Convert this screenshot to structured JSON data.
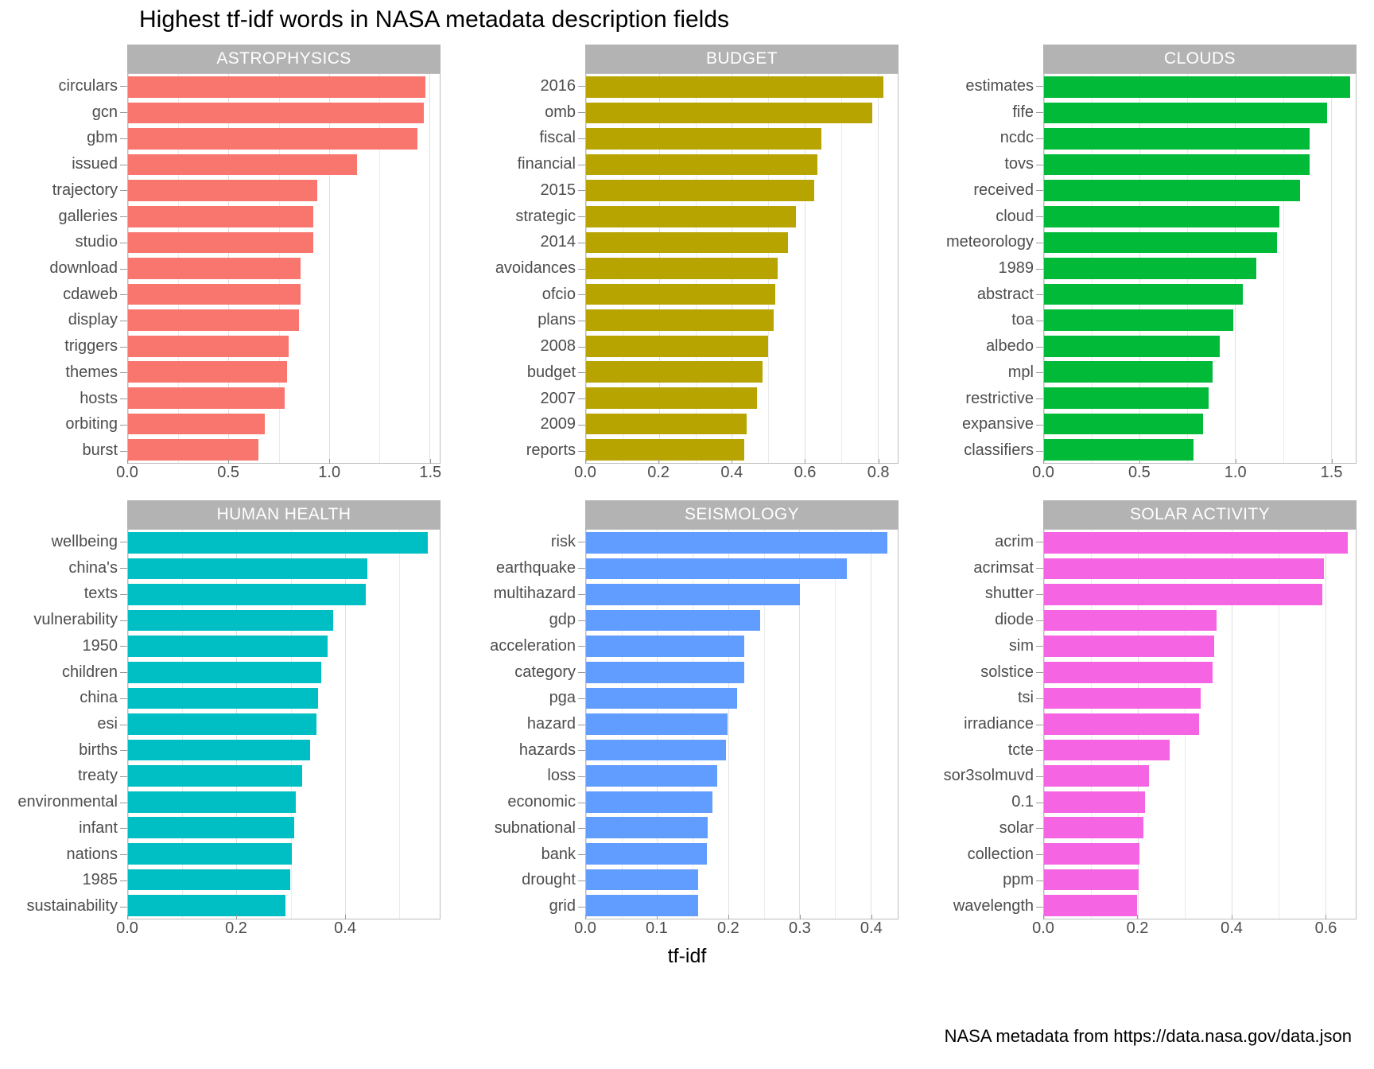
{
  "title": "Highest tf-idf words in NASA metadata description fields",
  "xlabel": "tf-idf",
  "caption": "NASA metadata from https://data.nasa.gov/data.json",
  "chart_data": {
    "type": "bar",
    "title": "Highest tf-idf words in NASA metadata description fields",
    "xlabel": "tf-idf",
    "ylabel": "",
    "orientation": "horizontal",
    "grid": true,
    "legend": "none",
    "facet_layout": "3 columns x 2 rows",
    "caption": "NASA metadata from https://data.nasa.gov/data.json",
    "panels": [
      {
        "name": "ASTROPHYSICS",
        "color": "#f8766d",
        "xlim": [
          0,
          1.55
        ],
        "xticks": [
          0.0,
          0.5,
          1.0,
          1.5
        ],
        "xticklabels": [
          "0.0",
          "0.5",
          "1.0",
          "1.5"
        ],
        "categories": [
          "circulars",
          "gcn",
          "gbm",
          "issued",
          "trajectory",
          "galleries",
          "studio",
          "download",
          "cdaweb",
          "display",
          "triggers",
          "themes",
          "hosts",
          "orbiting",
          "burst"
        ],
        "values": [
          1.48,
          1.47,
          1.44,
          1.14,
          0.94,
          0.92,
          0.92,
          0.86,
          0.86,
          0.85,
          0.8,
          0.79,
          0.78,
          0.68,
          0.65
        ]
      },
      {
        "name": "BUDGET",
        "color": "#b8a400",
        "xlim": [
          0,
          0.855
        ],
        "xticks": [
          0.0,
          0.2,
          0.4,
          0.6,
          0.8
        ],
        "xticklabels": [
          "0.0",
          "0.2",
          "0.4",
          "0.6",
          "0.8"
        ],
        "categories": [
          "2016",
          "omb",
          "fiscal",
          "financial",
          "2015",
          "strategic",
          "2014",
          "avoidances",
          "ofcio",
          "plans",
          "2008",
          "budget",
          "2007",
          "2009",
          "reports"
        ],
        "values": [
          0.815,
          0.785,
          0.645,
          0.635,
          0.625,
          0.575,
          0.555,
          0.525,
          0.52,
          0.515,
          0.5,
          0.485,
          0.47,
          0.44,
          0.435
        ]
      },
      {
        "name": "CLOUDS",
        "color": "#00ba38",
        "xlim": [
          0,
          1.63
        ],
        "xticks": [
          0.0,
          0.5,
          1.0,
          1.5
        ],
        "xticklabels": [
          "0.0",
          "0.5",
          "1.0",
          "1.5"
        ],
        "categories": [
          "estimates",
          "fife",
          "ncdc",
          "tovs",
          "received",
          "cloud",
          "meteorology",
          "1989",
          "abstract",
          "toa",
          "albedo",
          "mpl",
          "restrictive",
          "expansive",
          "classifiers"
        ],
        "values": [
          1.6,
          1.48,
          1.39,
          1.39,
          1.34,
          1.23,
          1.22,
          1.11,
          1.04,
          0.99,
          0.92,
          0.88,
          0.86,
          0.83,
          0.78
        ]
      },
      {
        "name": "HUMAN HEALTH",
        "color": "#00bfc4",
        "xlim": [
          0,
          0.575
        ],
        "xticks": [
          0.0,
          0.2,
          0.4
        ],
        "xticklabels": [
          "0.0",
          "0.2",
          "0.4"
        ],
        "categories": [
          "wellbeing",
          "china's",
          "texts",
          "vulnerability",
          "1950",
          "children",
          "china",
          "esi",
          "births",
          "treaty",
          "environmental",
          "infant",
          "nations",
          "1985",
          "sustainability"
        ],
        "values": [
          0.553,
          0.442,
          0.438,
          0.378,
          0.368,
          0.357,
          0.35,
          0.347,
          0.336,
          0.321,
          0.309,
          0.307,
          0.302,
          0.299,
          0.29
        ]
      },
      {
        "name": "SEISMOLOGY",
        "color": "#619cff",
        "xlim": [
          0,
          0.438
        ],
        "xticks": [
          0.0,
          0.1,
          0.2,
          0.3,
          0.4
        ],
        "xticklabels": [
          "0.0",
          "0.1",
          "0.2",
          "0.3",
          "0.4"
        ],
        "categories": [
          "risk",
          "earthquake",
          "multihazard",
          "gdp",
          "acceleration",
          "category",
          "pga",
          "hazard",
          "hazards",
          "loss",
          "economic",
          "subnational",
          "bank",
          "drought",
          "grid"
        ],
        "values": [
          0.424,
          0.366,
          0.301,
          0.245,
          0.222,
          0.222,
          0.212,
          0.199,
          0.197,
          0.184,
          0.178,
          0.171,
          0.17,
          0.158,
          0.158
        ]
      },
      {
        "name": "SOLAR ACTIVITY",
        "color": "#f564e3",
        "xlim": [
          0,
          0.665
        ],
        "xticks": [
          0.0,
          0.2,
          0.4,
          0.6
        ],
        "xticklabels": [
          "0.0",
          "0.2",
          "0.4",
          "0.6"
        ],
        "categories": [
          "acrim",
          "acrimsat",
          "shutter",
          "diode",
          "sim",
          "solstice",
          "tsi",
          "irradiance",
          "tcte",
          "sor3solmuvd",
          "0.1",
          "solar",
          "collection",
          "ppm",
          "wavelength"
        ],
        "values": [
          0.648,
          0.597,
          0.594,
          0.368,
          0.363,
          0.36,
          0.334,
          0.331,
          0.268,
          0.224,
          0.216,
          0.212,
          0.203,
          0.202,
          0.199
        ]
      }
    ]
  }
}
